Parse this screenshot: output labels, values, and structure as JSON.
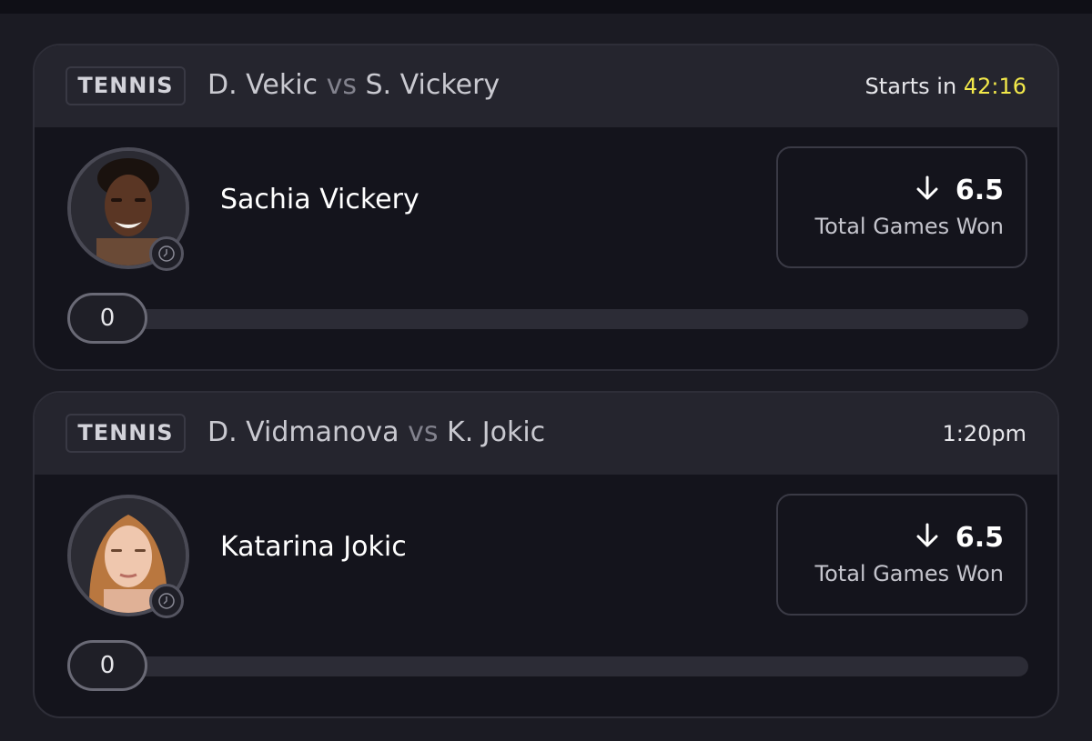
{
  "cards": [
    {
      "sport": "TENNIS",
      "player_a": "D. Vekic",
      "vs": "vs",
      "player_b": "S. Vickery",
      "start_prefix": "Starts in",
      "start_countdown": "42:16",
      "start_time": "",
      "player_name": "Sachia Vickery",
      "prop_direction_icon": "arrow-down-icon",
      "prop_value": "6.5",
      "prop_label": "Total Games Won",
      "progress_count": "0",
      "progress_fraction": 0
    },
    {
      "sport": "TENNIS",
      "player_a": "D. Vidmanova",
      "vs": "vs",
      "player_b": "K. Jokic",
      "start_prefix": "",
      "start_countdown": "",
      "start_time": "1:20pm",
      "player_name": "Katarina Jokic",
      "prop_direction_icon": "arrow-down-icon",
      "prop_value": "6.5",
      "prop_label": "Total Games Won",
      "progress_count": "0",
      "progress_fraction": 0
    }
  ],
  "colors": {
    "countdown": "#f2e84a",
    "card_bg": "#14141c",
    "header_bg": "#25252e"
  }
}
